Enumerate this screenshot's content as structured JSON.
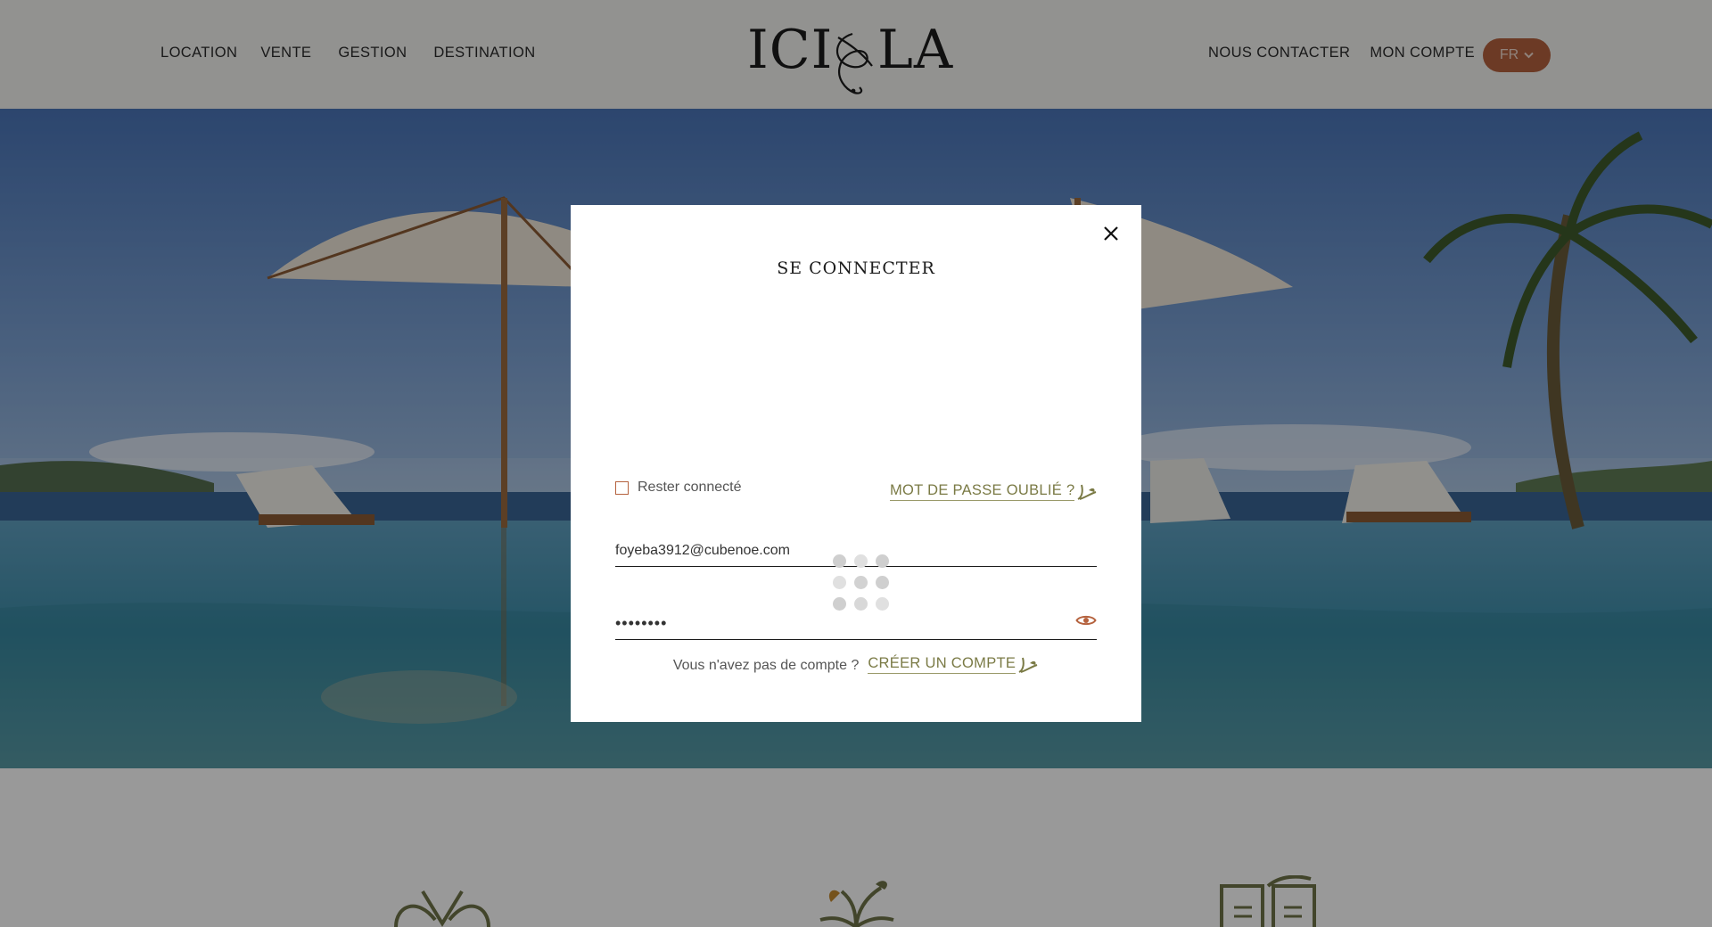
{
  "header": {
    "nav_left": [
      "LOCATION",
      "VENTE",
      "GESTION",
      "DESTINATION"
    ],
    "nav_right": [
      "NOUS CONTACTER",
      "MON COMPTE"
    ],
    "logo": "ICI & LA",
    "language": "FR"
  },
  "modal": {
    "title": "SE CONNECTER",
    "email_value": "foyeba3912@cubenoe.com",
    "password_value": "••••••••",
    "remember_label": "Rester connecté",
    "forgot_link": "MOT DE PASSE OUBLIÉ ?",
    "signup_prompt": "Vous n'avez pas de compte ?",
    "signup_link": "CRÉER UN COMPTE"
  },
  "colors": {
    "accent": "#b5623e",
    "link_olive": "#7a7a45",
    "header_bg": "#f3f3f1"
  },
  "icons": [
    "close-icon",
    "eye-icon",
    "chevron-down-icon",
    "loading-spinner-icon",
    "link-flourish-icon"
  ]
}
